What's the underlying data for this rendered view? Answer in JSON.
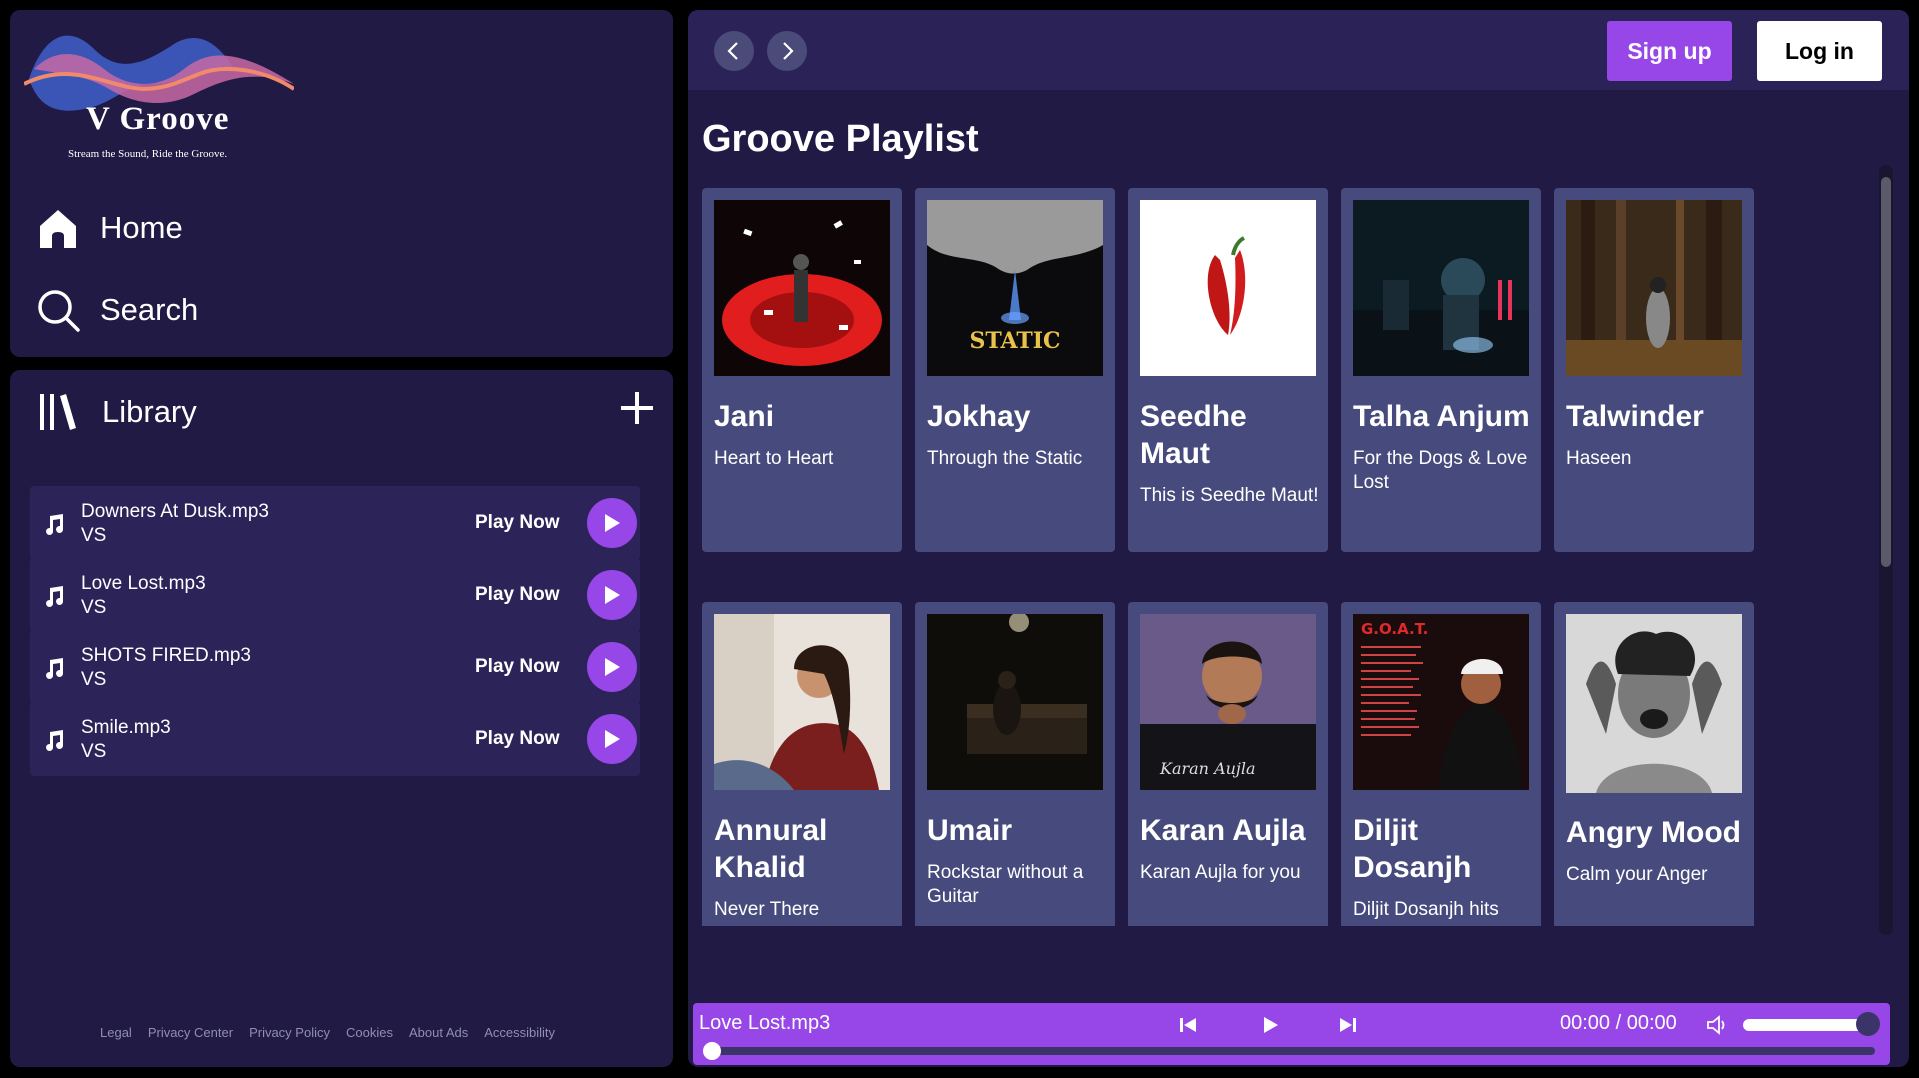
{
  "brand": {
    "name": "V Groove",
    "tagline": "Stream the Sound, Ride the Groove."
  },
  "nav": {
    "home": "Home",
    "search": "Search"
  },
  "library": {
    "title": "Library",
    "tracks": [
      {
        "title": "Downers At Dusk.mp3",
        "artist": "VS",
        "action": "Play Now"
      },
      {
        "title": "Love Lost.mp3",
        "artist": "VS",
        "action": "Play Now"
      },
      {
        "title": "SHOTS FIRED.mp3",
        "artist": "VS",
        "action": "Play Now"
      },
      {
        "title": "Smile.mp3",
        "artist": "VS",
        "action": "Play Now"
      }
    ]
  },
  "footer": [
    "Legal",
    "Privacy Center",
    "Privacy Policy",
    "Cookies",
    "About Ads",
    "Accessibility"
  ],
  "header": {
    "signup": "Sign up",
    "login": "Log in"
  },
  "playlist": {
    "title": "Groove Playlist",
    "cards": [
      {
        "artist": "Jani",
        "desc": "Heart to Heart"
      },
      {
        "artist": "Jokhay",
        "desc": "Through the Static"
      },
      {
        "artist": "Seedhe Maut",
        "desc": "This is Seedhe Maut!"
      },
      {
        "artist": "Talha Anjum",
        "desc": "For the Dogs & Love Lost"
      },
      {
        "artist": "Talwinder",
        "desc": "Haseen"
      },
      {
        "artist": "Annural Khalid",
        "desc": "Never There"
      },
      {
        "artist": "Umair",
        "desc": "Rockstar without a Guitar"
      },
      {
        "artist": "Karan Aujla",
        "desc": "Karan Aujla for you"
      },
      {
        "artist": "Diljit Dosanjh",
        "desc": "Diljit Dosanjh hits"
      },
      {
        "artist": "Angry Mood",
        "desc": "Calm your Anger"
      }
    ]
  },
  "player": {
    "track": "Love Lost.mp3",
    "time": "00:00 / 00:00",
    "volume": 0.9,
    "progress": 0.0
  },
  "colors": {
    "accent": "#9747e8",
    "panel": "#211a44",
    "card": "#474a7c"
  }
}
